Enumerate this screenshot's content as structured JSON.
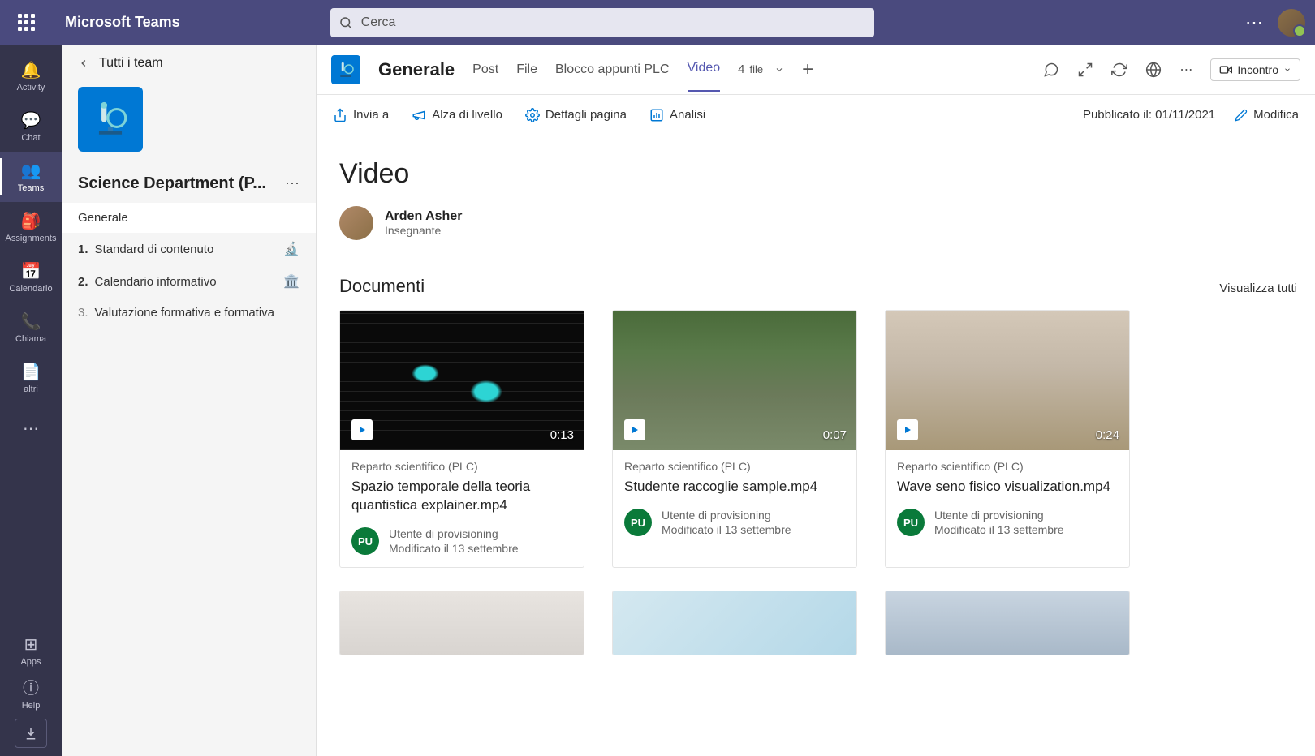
{
  "app": {
    "title": "Microsoft Teams"
  },
  "search": {
    "placeholder": "Cerca"
  },
  "rail": {
    "items": [
      {
        "label": "Activity"
      },
      {
        "label": "Chat"
      },
      {
        "label": "Teams"
      },
      {
        "label": "Assignments"
      },
      {
        "label": "Calendario"
      },
      {
        "label": "Chiama"
      },
      {
        "label": "altri"
      }
    ],
    "apps": "Apps",
    "help": "Help"
  },
  "sidebar": {
    "back": "Tutti i team",
    "team": "Science Department (P...",
    "channels": [
      {
        "label": "Generale",
        "num": "",
        "icon": ""
      },
      {
        "label": "Standard di contenuto",
        "num": "1.",
        "icon": "microscope"
      },
      {
        "label": "Calendario informativo",
        "num": "2.",
        "icon": "building"
      },
      {
        "label": "Valutazione formativa e formativa",
        "num": "3.",
        "icon": ""
      }
    ]
  },
  "header": {
    "channel": "Generale",
    "tabs": [
      {
        "label": "Post"
      },
      {
        "label": "File"
      },
      {
        "label": "Blocco appunti PLC"
      },
      {
        "label": "Video"
      }
    ],
    "count_num": "4",
    "count_label": "file",
    "meet": "Incontro"
  },
  "toolbar": {
    "send": "Invia a",
    "promote": "Alza di livello",
    "details": "Dettagli pagina",
    "analysis": "Analisi",
    "published": "Pubblicato il: 01/11/2021",
    "edit": "Modifica"
  },
  "page": {
    "title": "Video",
    "author": "Arden Asher",
    "role": "Insegnante"
  },
  "section": {
    "title": "Documenti",
    "view_all": "Visualizza tutti"
  },
  "cards": [
    {
      "dept": "Reparto scientifico (PLC)",
      "title": "Spazio temporale della teoria quantistica explainer.mp4",
      "duration": "0:13",
      "user": "Utente di provisioning",
      "modified": "Modificato il 13 settembre",
      "initials": "PU"
    },
    {
      "dept": "Reparto scientifico (PLC)",
      "title": "Studente raccoglie sample.mp4",
      "duration": "0:07",
      "user": "Utente di provisioning",
      "modified": "Modificato il 13 settembre",
      "initials": "PU"
    },
    {
      "dept": "Reparto scientifico (PLC)",
      "title": "Wave seno fisico visualization.mp4",
      "duration": "0:24",
      "user": "Utente di provisioning",
      "modified": "Modificato il 13 settembre",
      "initials": "PU"
    }
  ]
}
